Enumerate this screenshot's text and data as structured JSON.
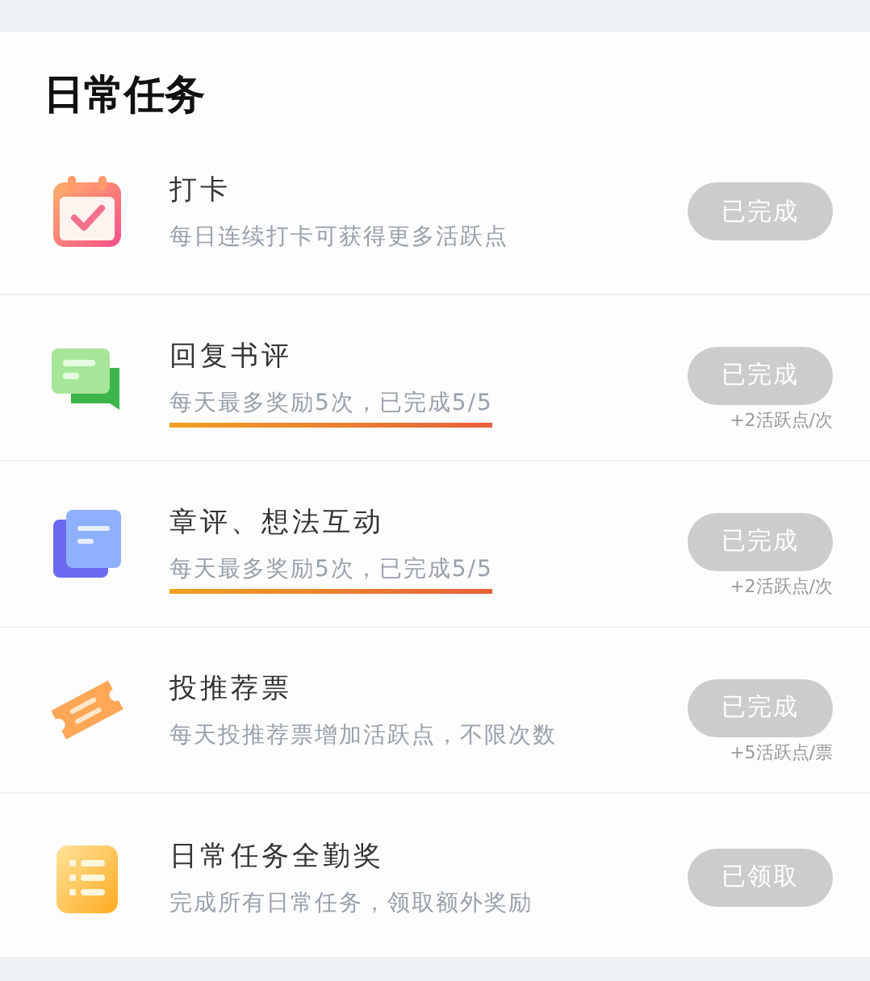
{
  "title": "日常任务",
  "tasks": [
    {
      "kind": "calendar",
      "name": "打卡",
      "description": "每日连续打卡可获得更多活跃点",
      "highlighted": false,
      "button": "已完成",
      "done": true
    },
    {
      "kind": "chat",
      "name": "回复书评",
      "description": "每天最多奖励5次，已完成5/5",
      "highlighted": true,
      "button": "已完成",
      "done": true,
      "reward": "+2活跃点/次"
    },
    {
      "kind": "documents",
      "name": "章评、想法互动",
      "description": "每天最多奖励5次，已完成5/5",
      "highlighted": true,
      "button": "已完成",
      "done": true,
      "reward": "+2活跃点/次"
    },
    {
      "kind": "ticket",
      "name": "投推荐票",
      "description": "每天投推荐票增加活跃点，不限次数",
      "highlighted": false,
      "button": "已完成",
      "done": true,
      "reward": "+5活跃点/票"
    },
    {
      "kind": "list",
      "name": "日常任务全勤奖",
      "description": "完成所有日常任务，领取额外奖励",
      "highlighted": false,
      "button": "已领取",
      "done": true
    }
  ]
}
